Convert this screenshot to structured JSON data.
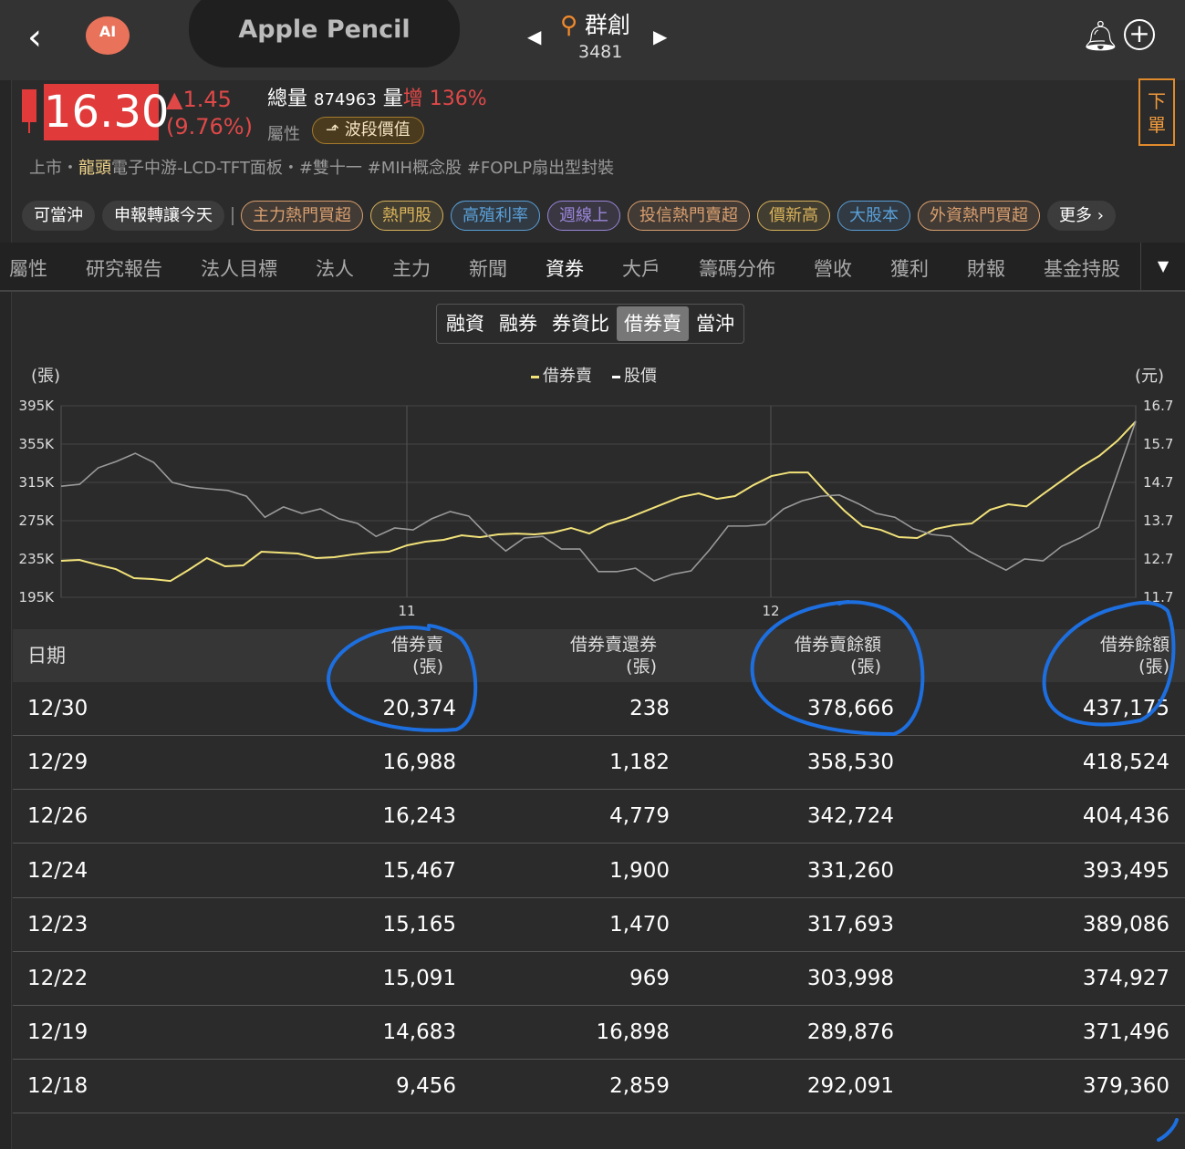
{
  "header": {
    "back_icon": "chevron-left-icon",
    "ai_label": "AI",
    "search_pill": "Apple Pencil",
    "stock_name": "群創",
    "stock_code": "3481",
    "bell_icon": "bell-icon",
    "add_icon": "plus-circle-icon"
  },
  "quote": {
    "price": "16.30",
    "change": "▲1.45",
    "change_pct": "(9.76%)",
    "volume_label": "總量",
    "volume": "874963",
    "vol_inc_label": "量",
    "vol_inc_word": "增",
    "vol_inc_pct": "136%",
    "attr_label": "屬性",
    "wave_button": "波段價值",
    "order_button": "下單",
    "accent_up": "#e03a3a"
  },
  "tags_line": {
    "market": "上市",
    "sep1": "・",
    "leader": "龍頭",
    "industry": "電子中游-LCD-TFT面板",
    "sep2": "・",
    "tags": "#雙十一  #MIH概念股  #FOPLP扇出型封裝"
  },
  "chips": [
    {
      "label": "可當沖",
      "style": "g"
    },
    {
      "label": "申報轉讓今天",
      "style": "g"
    },
    {
      "label": "主力熱門買超",
      "color": "#d9a070"
    },
    {
      "label": "熱門股",
      "color": "#d9b35a"
    },
    {
      "label": "高殖利率",
      "color": "#5aa0d9"
    },
    {
      "label": "週線上",
      "color": "#9a86d9"
    },
    {
      "label": "投信熱門賣超",
      "color": "#d9a070"
    },
    {
      "label": "價新高",
      "color": "#d9b35a"
    },
    {
      "label": "大股本",
      "color": "#5aa0d9"
    },
    {
      "label": "外資熱門買超",
      "color": "#d9a070"
    },
    {
      "label": "更多 ›",
      "style": "g"
    }
  ],
  "tabs": [
    "屬性",
    "研究報告",
    "法人目標",
    "法人",
    "主力",
    "新聞",
    "資券",
    "大戶",
    "籌碼分佈",
    "營收",
    "獲利",
    "財報",
    "基金持股"
  ],
  "active_tab": "資券",
  "subtabs": [
    "融資",
    "融券",
    "券資比",
    "借券賣",
    "當沖"
  ],
  "active_subtab": "借券賣",
  "chart_data": {
    "type": "line",
    "left_unit": "(張)",
    "right_unit": "(元)",
    "legend": [
      "借券賣",
      "股價"
    ],
    "legend_placement": "top-center",
    "grid": true,
    "x_ticks": [
      "11",
      "12"
    ],
    "left_ticks": [
      "395K",
      "355K",
      "315K",
      "275K",
      "235K",
      "195K"
    ],
    "right_ticks": [
      "16.7",
      "15.7",
      "14.7",
      "13.7",
      "12.7",
      "11.7"
    ],
    "left_ylim": [
      195000,
      395000
    ],
    "right_ylim": [
      11.7,
      16.7
    ],
    "series": [
      {
        "name": "借券賣",
        "axis": "left",
        "color": "#f2e27a",
        "values": [
          233100,
          234000,
          229000,
          224500,
          215000,
          214000,
          212000,
          223600,
          236000,
          227400,
          228300,
          242600,
          241700,
          240700,
          236000,
          236900,
          239700,
          241700,
          242600,
          249300,
          253100,
          255000,
          259700,
          257800,
          260700,
          261600,
          260700,
          262600,
          267400,
          261600,
          271200,
          276900,
          284500,
          292100,
          299700,
          303500,
          297800,
          300700,
          312100,
          321600,
          325400,
          325400,
          304500,
          285500,
          269300,
          265400,
          257800,
          256900,
          266400,
          270200,
          272100,
          286400,
          292091,
          289876,
          303998,
          317693,
          331260,
          342724,
          358530,
          378666
        ]
      },
      {
        "name": "股價",
        "axis": "right",
        "color": "#9a9a9a",
        "values": [
          14.6,
          14.65,
          15.08,
          15.25,
          15.46,
          15.22,
          14.7,
          14.58,
          14.53,
          14.49,
          14.34,
          13.79,
          14.06,
          13.89,
          14.01,
          13.75,
          13.63,
          13.29,
          13.51,
          13.46,
          13.75,
          13.94,
          13.82,
          13.32,
          12.91,
          13.25,
          13.29,
          12.96,
          12.96,
          12.37,
          12.37,
          12.46,
          12.13,
          12.3,
          12.39,
          12.94,
          13.56,
          13.56,
          13.6,
          14.01,
          14.22,
          14.34,
          14.37,
          14.15,
          13.89,
          13.79,
          13.49,
          13.34,
          13.29,
          12.91,
          12.65,
          12.41,
          12.7,
          12.65,
          13.03,
          13.25,
          13.53,
          14.91,
          16.3
        ]
      }
    ]
  },
  "table": {
    "headers": [
      {
        "l1": "日期"
      },
      {
        "l1": "借券賣",
        "l2": "(張)"
      },
      {
        "l1": "借券賣還券",
        "l2": "(張)"
      },
      {
        "l1": "借券賣餘額",
        "l2": "(張)"
      },
      {
        "l1": "借券餘額",
        "l2": "(張)"
      }
    ],
    "rows": [
      [
        "12/30",
        "20,374",
        "238",
        "378,666",
        "437,175"
      ],
      [
        "12/29",
        "16,988",
        "1,182",
        "358,530",
        "418,524"
      ],
      [
        "12/26",
        "16,243",
        "4,779",
        "342,724",
        "404,436"
      ],
      [
        "12/24",
        "15,467",
        "1,900",
        "331,260",
        "393,495"
      ],
      [
        "12/23",
        "15,165",
        "1,470",
        "317,693",
        "389,086"
      ],
      [
        "12/22",
        "15,091",
        "969",
        "303,998",
        "374,927"
      ],
      [
        "12/19",
        "14,683",
        "16,898",
        "289,876",
        "371,496"
      ],
      [
        "12/18",
        "9,456",
        "2,859",
        "292,091",
        "379,360"
      ]
    ]
  }
}
